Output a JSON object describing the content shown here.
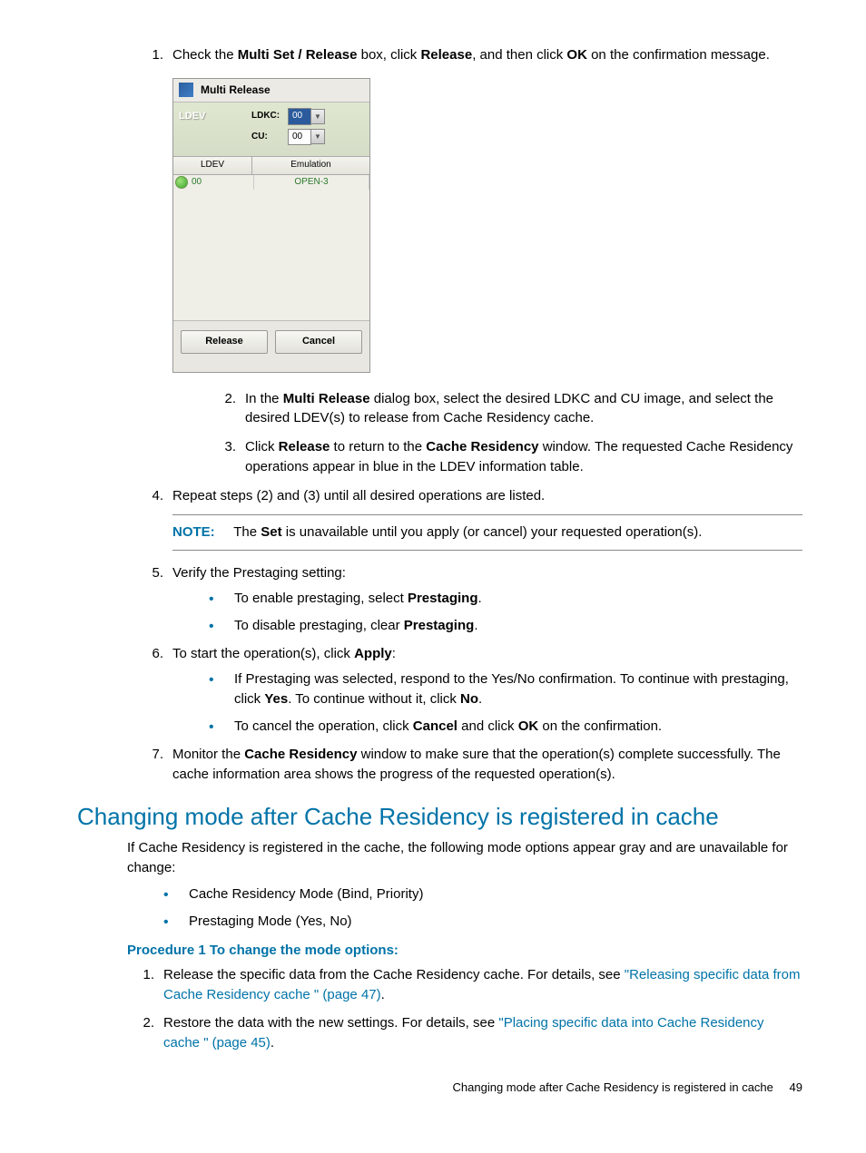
{
  "steps": {
    "s1_pre": "Check the ",
    "s1_b1": "Multi Set / Release",
    "s1_mid1": " box, click ",
    "s1_b2": "Release",
    "s1_mid2": ", and then click ",
    "s1_b3": "OK",
    "s1_post": " on the confirmation message.",
    "s2_pre": "In the ",
    "s2_b1": "Multi Release",
    "s2_post": " dialog box, select the desired LDKC and CU image, and select the desired LDEV(s) to release from Cache Residency cache.",
    "s3_pre": "Click ",
    "s3_b1": "Release",
    "s3_mid": " to return to the ",
    "s3_b2": "Cache Residency",
    "s3_post": " window. The requested Cache Residency operations appear in blue in the LDEV information table.",
    "s4": "Repeat steps (2) and (3) until all desired operations are listed.",
    "note_label": "NOTE:",
    "note_pre": "The ",
    "note_b": "Set",
    "note_post": " is unavailable until you apply (or cancel) your requested operation(s).",
    "s5": "Verify the Prestaging setting:",
    "s5a_pre": "To enable prestaging, select ",
    "s5a_b": "Prestaging",
    "s5b_pre": "To disable prestaging, clear ",
    "s5b_b": "Prestaging",
    "s6_pre": "To start the operation(s), click ",
    "s6_b": "Apply",
    "s6a_pre": "If Prestaging was selected, respond to the Yes/No confirmation. To continue with prestaging, click ",
    "s6a_b1": "Yes",
    "s6a_mid": ". To continue without it, click ",
    "s6a_b2": "No",
    "s6b_pre": "To cancel the operation, click ",
    "s6b_b1": "Cancel",
    "s6b_mid": " and click ",
    "s6b_b2": "OK",
    "s6b_post": " on the confirmation.",
    "s7_pre": "Monitor the ",
    "s7_b": "Cache Residency",
    "s7_post": " window to make sure that the operation(s) complete successfully. The cache information area shows the progress of the requested operation(s)."
  },
  "dialog": {
    "title": "Multi Release",
    "ldev_tab": "LDEV",
    "ldkc_label": "LDKC:",
    "cu_label": "CU:",
    "ldkc_val": "00",
    "cu_val": "00",
    "th_ldev": "LDEV",
    "th_emu": "Emulation",
    "row_ldev": "00",
    "row_emu": "OPEN-3",
    "btn_release": "Release",
    "btn_cancel": "Cancel"
  },
  "section": {
    "heading": "Changing mode after Cache Residency is registered in cache",
    "intro": "If Cache Residency is registered in the cache, the following mode options appear gray and are unavailable for change:",
    "b1": "Cache Residency Mode (Bind, Priority)",
    "b2": "Prestaging Mode (Yes, No)",
    "proc_label": "Procedure 1 To change the mode options:",
    "p1_pre": "Release the specific data from the Cache Residency cache. For details, see ",
    "p1_link": "\"Releasing specific data from Cache Residency cache \" (page 47)",
    "p2_pre": "Restore the data with the new settings. For details, see ",
    "p2_link": "\"Placing specific data into Cache Residency cache \" (page 45)"
  },
  "footer": {
    "text": "Changing mode after Cache Residency is registered in cache",
    "page": "49"
  }
}
